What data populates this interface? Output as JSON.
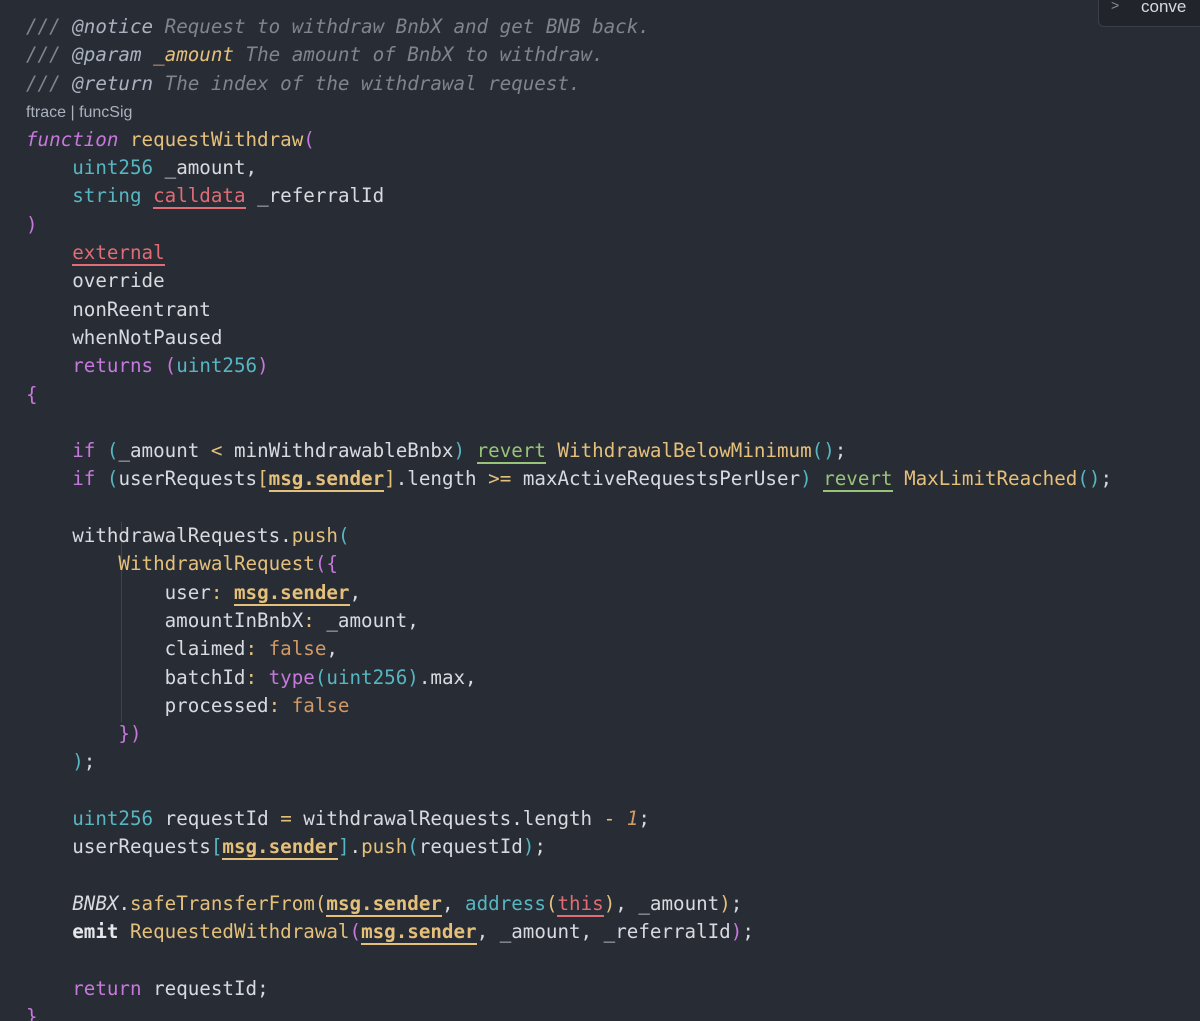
{
  "corner_chip": {
    "label": "conve",
    "icon": "chevron-right-icon"
  },
  "doc": {
    "tag_notice": "@notice",
    "text_notice": " Request to withdraw BnbX and get BNB back.",
    "tag_param": "@param",
    "param_name": "_amount",
    "text_param": " The amount of BnbX to withdraw.",
    "tag_return": "@return",
    "text_return": " The index of the withdrawal request."
  },
  "codelens": "ftrace | funcSig",
  "function_name": "requestWithdraw",
  "params": [
    "uint256 _amount,",
    "string calldata _referralId"
  ],
  "modifiers": [
    "external",
    "override",
    "nonReentrant",
    "whenNotPaused"
  ],
  "returns_type": "uint256",
  "errors": [
    "WithdrawalBelowMinimum",
    "MaxLimitReached"
  ],
  "struct_name": "WithdrawalRequest",
  "struct_fields": [
    {
      "key": "user",
      "value": "msg.sender"
    },
    {
      "key": "amountInBnbX",
      "value": "_amount"
    },
    {
      "key": "claimed",
      "value": "false"
    },
    {
      "key": "batchId",
      "value": "type(uint256).max"
    },
    {
      "key": "processed",
      "value": "false"
    }
  ],
  "event_name": "RequestedWithdrawal",
  "return_var": "requestId"
}
